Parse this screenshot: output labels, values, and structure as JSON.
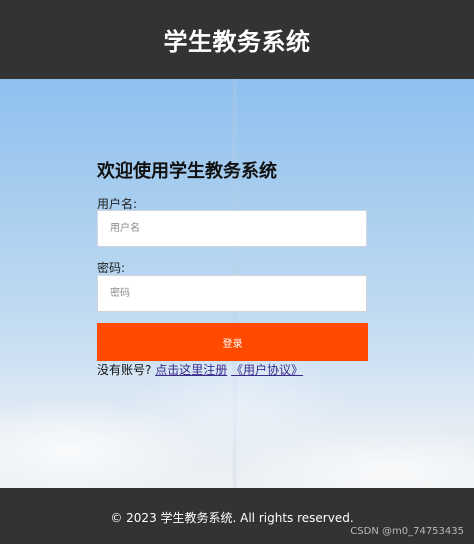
{
  "header": {
    "title": "学生教务系统"
  },
  "login_form": {
    "title": "欢迎使用学生教务系统",
    "username_label": "用户名:",
    "username_placeholder": "用户名",
    "password_label": "密码:",
    "password_placeholder": "密码",
    "submit_label": "登录",
    "no_account_text": "没有账号?",
    "register_link": "点击这里注册",
    "agreement_link": "《用户协议》"
  },
  "footer": {
    "copyright": "© 2023 学生教务系统. All rights reserved.",
    "watermark": "CSDN @m0_74753435"
  },
  "colors": {
    "header_bg": "#333333",
    "button_bg": "#ff4a00",
    "footer_bg": "#333333"
  }
}
